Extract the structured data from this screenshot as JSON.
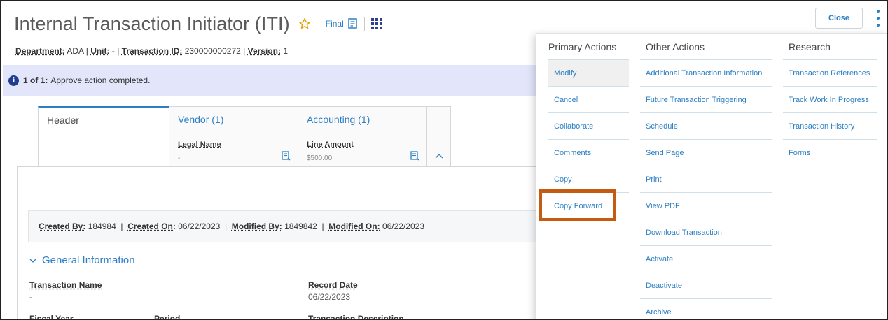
{
  "header": {
    "title": "Internal Transaction Initiator (ITI)",
    "status": "Final"
  },
  "meta": {
    "department_label": "Department:",
    "department_value": "ADA",
    "unit_label": "Unit:",
    "unit_value": "-",
    "txn_label": "Transaction ID:",
    "txn_value": "230000000272",
    "version_label": "Version:",
    "version_value": "1",
    "sep": "|"
  },
  "banner": {
    "count": "1 of 1:",
    "message": "Approve action completed."
  },
  "tabs": [
    {
      "title": "Header"
    },
    {
      "title": "Vendor (1)",
      "field_label": "Legal Name",
      "field_value": "-"
    },
    {
      "title": "Accounting (1)",
      "field_label": "Line Amount",
      "field_value": "$500.00"
    }
  ],
  "audit": {
    "created_by_label": "Created By:",
    "created_by_value": "184984",
    "created_on_label": "Created On:",
    "created_on_value": "06/22/2023",
    "modified_by_label": "Modified By:",
    "modified_by_value": "1849842",
    "modified_on_label": "Modified On:",
    "modified_on_value": "06/22/2023"
  },
  "general": {
    "title": "General Information",
    "transaction_name_label": "Transaction Name",
    "transaction_name_value": "-",
    "record_date_label": "Record Date",
    "record_date_value": "06/22/2023",
    "fiscal_year_label": "Fiscal Year",
    "period_label": "Period",
    "transaction_description_label": "Transaction Description"
  },
  "toolbar": {
    "close_label": "Close"
  },
  "menu": {
    "primary": {
      "heading": "Primary Actions",
      "items": [
        "Modify",
        "Cancel",
        "Collaborate",
        "Comments",
        "Copy",
        "Copy Forward"
      ]
    },
    "other": {
      "heading": "Other Actions",
      "items": [
        "Additional Transaction Information",
        "Future Transaction Triggering",
        "Schedule",
        "Send Page",
        "Print",
        "View PDF",
        "Download Transaction",
        "Activate",
        "Deactivate",
        "Archive"
      ]
    },
    "research": {
      "heading": "Research",
      "items": [
        "Transaction References",
        "Track Work In Progress",
        "Transaction History",
        "Forms"
      ]
    }
  },
  "colors": {
    "accent": "#2d7fc3",
    "banner_bg": "#e3e6fb",
    "highlight_box": "#c55a11",
    "star": "#e6a100"
  }
}
